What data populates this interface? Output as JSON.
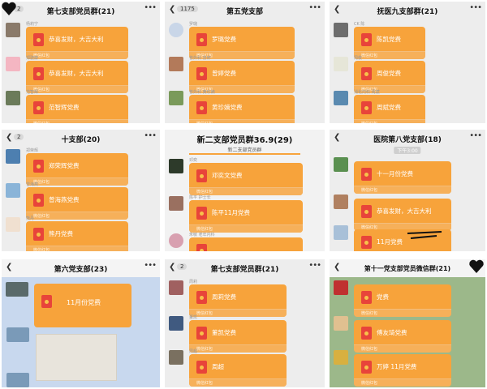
{
  "common": {
    "back_icon": "chevron-left-icon",
    "more_icon": "more-dots-icon",
    "packet_icon": "red-envelope-icon",
    "packet_footer": "微信红包",
    "packet_color": "#f7a33b"
  },
  "panels": [
    {
      "badge": "2",
      "title": "第七支部党员群(21)",
      "messages": [
        {
          "sender": "杨莉宁",
          "label": "恭喜发财，大吉大利"
        },
        {
          "sender": "郑骁康",
          "label": "恭喜发财，大吉大利"
        },
        {
          "sender": "范智辉",
          "label": "范智辉党费"
        }
      ]
    },
    {
      "badge": "1175",
      "title": "第五党支部",
      "messages": [
        {
          "sender": "罗璐",
          "label": "罗璐党费"
        },
        {
          "sender": "普外科 曾婷",
          "label": "曾婷党费"
        },
        {
          "sender": "普外科 黄珍嫡",
          "label": "黄珍嫡党费"
        }
      ]
    },
    {
      "badge": "",
      "title": "抚医九支部群(21)",
      "messages": [
        {
          "sender": "CK 陈",
          "label": "陈凯党费"
        },
        {
          "sender": "周俊",
          "label": "周俊党费"
        },
        {
          "sender": "消化内科 周斌",
          "label": "周斌党费"
        }
      ]
    },
    {
      "badge": "2",
      "title": "十支部(20)",
      "messages": [
        {
          "sender": "郑荣辉",
          "label": "郑荣辉党费"
        },
        {
          "sender": "曾海燕",
          "label": "曾海燕党费"
        },
        {
          "sender": "熊丹",
          "label": "熊丹党费"
        }
      ]
    },
    {
      "badge": "",
      "title": "新二支部党员群36.9(29)",
      "subtitle": "新二支部党员群",
      "messages": [
        {
          "sender": "邓奕",
          "label": "邓奕文党费"
        },
        {
          "sender": "陈平 护士长",
          "label": "陈平11月党费"
        },
        {
          "sender": "朱敏 老年内科",
          "label": ""
        }
      ]
    },
    {
      "badge": "",
      "title": "医院第八党支部(18)",
      "time": "下午3:00",
      "messages": [
        {
          "sender": "",
          "label": "十一月份党费"
        },
        {
          "sender": "",
          "label": "恭喜发财，大吉大利"
        },
        {
          "sender": "",
          "label": "11月党费"
        }
      ]
    },
    {
      "badge": "",
      "title": "第六党支部(23)",
      "messages": [
        {
          "sender": "",
          "label": "11月份党费"
        }
      ]
    },
    {
      "badge": "2",
      "title": "第七支部党员群(21)",
      "messages": [
        {
          "sender": "周莉",
          "label": "周莉党费"
        },
        {
          "sender": "董凯",
          "label": "董凯党费"
        },
        {
          "sender": "周超",
          "label": "周超"
        }
      ]
    },
    {
      "badge": "",
      "title": "第十一党支部党员微信群(21)",
      "messages": [
        {
          "sender": "",
          "label": "党费"
        },
        {
          "sender": "",
          "label": "傅友琦党费"
        },
        {
          "sender": "",
          "label": "万婷 11月党费"
        }
      ]
    }
  ]
}
